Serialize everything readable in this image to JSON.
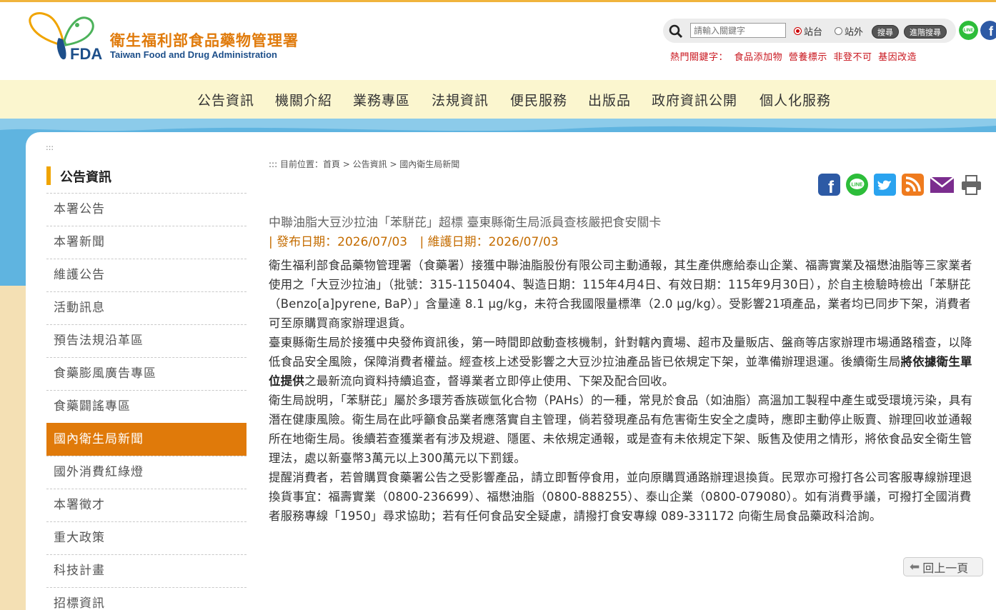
{
  "header": {
    "logo_cn": "衛生福利部食品藥物管理署",
    "logo_en": "Taiwan Food and Drug Administration",
    "logo_abbr": "FDA",
    "search_placeholder": "請輸入關鍵字",
    "radio_site": "站台",
    "radio_external": "站外",
    "search_button": "搜尋",
    "advanced_search_button": "進階搜尋",
    "hot_label": "熱門關鍵字：",
    "hot_keywords": [
      "食品添加物",
      "營養標示",
      "非登不可",
      "基因改造"
    ],
    "colors": {
      "accent": "#e07a0a",
      "brand_blue": "#1d4f8a",
      "hot_red": "#c9161e"
    }
  },
  "nav": [
    "公告資訊",
    "機關介紹",
    "業務專區",
    "法規資訊",
    "便民服務",
    "出版品",
    "政府資訊公開",
    "個人化服務"
  ],
  "sidebar": {
    "dots": ":::",
    "title": "公告資訊",
    "items": [
      "本署公告",
      "本署新聞",
      "維護公告",
      "活動訊息",
      "預告法規沿革區",
      "食藥膨風廣告專區",
      "食藥闢謠專區",
      "國內衛生局新聞",
      "國外消費紅綠燈",
      "本署徵才",
      "重大政策",
      "科技計畫",
      "招標資訊"
    ],
    "active_item": "國內衛生局新聞"
  },
  "breadcrumb": ":::  目前位置：首頁 > 公告資訊 > 國內衛生局新聞",
  "share_icons": [
    "facebook-icon",
    "line-icon",
    "twitter-icon",
    "rss-icon",
    "email-icon",
    "print-icon"
  ],
  "article": {
    "title": "中聯油脂大豆沙拉油「苯駢芘」超標 臺東縣衛生局派員查核嚴把食安關卡",
    "publish_date": "| 發布日期：2026/07/03",
    "update_date": "| 維護日期：2026/07/03",
    "p1": "衛生福利部食品藥物管理署（食藥署）接獲中聯油脂股份有限公司主動通報，其生產供應給泰山企業、福壽實業及福懋油脂等三家業者使用之「大豆沙拉油」（批號：315-1150404、製造日期：115年4月4日、有效日期：115年9月30日），於自主檢驗時檢出「苯駢芘（Benzo[a]pyrene, BaP）」含量達 8.1 μg/kg，未符合我國限量標準（2.0 μg/kg）。受影響21項產品，業者均已同步下架，消費者可至原購買商家辦理退貨。",
    "p2_a": "臺東縣衛生局於接獲中央發佈資訊後，第一時間即啟動查核機制，針對轄內賣場、超市及量販店、盤商等店家辦理市場通路稽查，以降低食品安全風險，保障消費者權益。經查核上述受影響之大豆沙拉油產品皆已依規定下架，並準備辦理退運。後續衛生局",
    "p2_bold": "將依據衛生單位提供",
    "p2_b": "之最新流向資料持續追查，督導業者立即停止使用、下架及配合回收。",
    "p3": "衛生局說明，「苯駢芘」屬於多環芳香族碳氫化合物（PAHs）的一種，常見於食品（如油脂）高溫加工製程中產生或受環境污染，具有潛在健康風險。衛生局在此呼籲食品業者應落實自主管理，倘若發現產品有危害衛生安全之虞時，應即主動停止販賣、辦理回收並通報所在地衛生局。後續若查獲業者有涉及規避、隱匿、未依規定通報，或是查有未依規定下架、販售及使用之情形，將依食品安全衛生管理法，處以新臺幣3萬元以上300萬元以下罰鍰。",
    "p4": "提醒消費者，若曾購買食藥署公告之受影響產品，請立即暫停食用，並向原購買通路辦理退換貨。民眾亦可撥打各公司客服專線辦理退換貨事宜：福壽實業（0800-236699）、福懋油脂（0800-888255）、泰山企業（0800-079080）。如有消費爭議，可撥打全國消費者服務專線「1950」尋求協助；若有任何食品安全疑慮，請撥打食安專線 089-331172 向衛生局食品藥政科洽詢。"
  },
  "back_button": "回上一頁"
}
